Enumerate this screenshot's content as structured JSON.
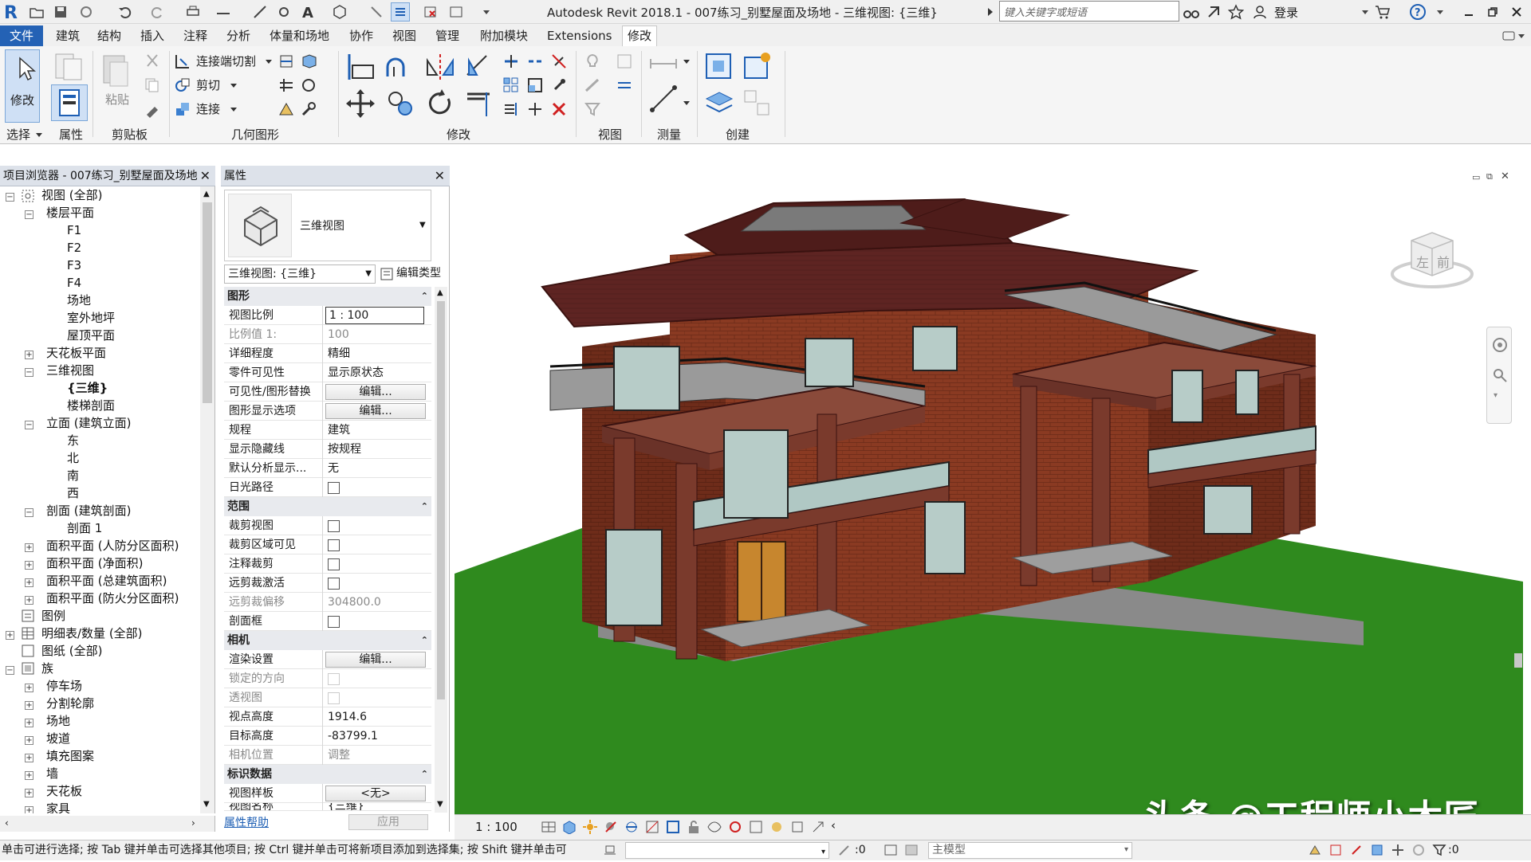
{
  "app": {
    "title": "Autodesk Revit 2018.1 -    007练习_别墅屋面及场地 - 三维视图: {三维}",
    "search_placeholder": "键入关键字或短语",
    "login_label": "登录"
  },
  "ribbon_tabs": [
    {
      "label": "文件"
    },
    {
      "label": "建筑"
    },
    {
      "label": "结构"
    },
    {
      "label": "插入"
    },
    {
      "label": "注释"
    },
    {
      "label": "分析"
    },
    {
      "label": "体量和场地"
    },
    {
      "label": "协作"
    },
    {
      "label": "视图"
    },
    {
      "label": "管理"
    },
    {
      "label": "附加模块"
    },
    {
      "label": "Extensions"
    },
    {
      "label": "修改"
    }
  ],
  "ribbon": {
    "modify_label": "修改",
    "paste_label": "粘贴",
    "cope_label": "连接端切割",
    "cut_label": "剪切",
    "join_label": "连接",
    "panels": {
      "select": "选择",
      "properties": "属性",
      "clipboard": "剪贴板",
      "geometry": "几何图形",
      "modify": "修改",
      "view": "视图",
      "measure": "测量",
      "create": "创建"
    }
  },
  "browser": {
    "title": "项目浏览器 - 007练习_别墅屋面及场地",
    "items": [
      {
        "label": "视图 (全部)"
      },
      {
        "label": "楼层平面"
      },
      {
        "label": "F1"
      },
      {
        "label": "F2"
      },
      {
        "label": "F3"
      },
      {
        "label": "F4"
      },
      {
        "label": "场地"
      },
      {
        "label": "室外地坪"
      },
      {
        "label": "屋顶平面"
      },
      {
        "label": "天花板平面"
      },
      {
        "label": "三维视图"
      },
      {
        "label": "{三维}"
      },
      {
        "label": "楼梯剖面"
      },
      {
        "label": "立面 (建筑立面)"
      },
      {
        "label": "东"
      },
      {
        "label": "北"
      },
      {
        "label": "南"
      },
      {
        "label": "西"
      },
      {
        "label": "剖面 (建筑剖面)"
      },
      {
        "label": "剖面 1"
      },
      {
        "label": "面积平面 (人防分区面积)"
      },
      {
        "label": "面积平面 (净面积)"
      },
      {
        "label": "面积平面 (总建筑面积)"
      },
      {
        "label": "面积平面 (防火分区面积)"
      },
      {
        "label": "图例"
      },
      {
        "label": "明细表/数量 (全部)"
      },
      {
        "label": "图纸 (全部)"
      },
      {
        "label": "族"
      },
      {
        "label": "停车场"
      },
      {
        "label": "分割轮廓"
      },
      {
        "label": "场地"
      },
      {
        "label": "坡道"
      },
      {
        "label": "填充图案"
      },
      {
        "label": "墙"
      },
      {
        "label": "天花板"
      },
      {
        "label": "家具"
      }
    ]
  },
  "properties": {
    "title": "属性",
    "type_name": "三维视图",
    "view_selector": "三维视图: {三维}",
    "edit_type": "编辑类型",
    "groups": {
      "graphics": "图形",
      "extents": "范围",
      "camera": "相机",
      "identity": "标识数据"
    },
    "rows": {
      "view_scale": {
        "name": "视图比例",
        "value": "1 : 100"
      },
      "scale_value": {
        "name": "比例值 1:",
        "value": "100"
      },
      "detail_level": {
        "name": "详细程度",
        "value": "精细"
      },
      "parts_visibility": {
        "name": "零件可见性",
        "value": "显示原状态"
      },
      "vg_overrides": {
        "name": "可见性/图形替换",
        "value": "编辑..."
      },
      "graphic_display": {
        "name": "图形显示选项",
        "value": "编辑..."
      },
      "discipline": {
        "name": "规程",
        "value": "建筑"
      },
      "hidden_lines": {
        "name": "显示隐藏线",
        "value": "按规程"
      },
      "analysis_display": {
        "name": "默认分析显示...",
        "value": "无"
      },
      "sun_path": {
        "name": "日光路径"
      },
      "crop_view": {
        "name": "裁剪视图"
      },
      "crop_visible": {
        "name": "裁剪区域可见"
      },
      "annotation_crop": {
        "name": "注释裁剪"
      },
      "far_clip_active": {
        "name": "远剪裁激活"
      },
      "far_clip_offset": {
        "name": "远剪裁偏移",
        "value": "304800.0"
      },
      "section_box": {
        "name": "剖面框"
      },
      "render_settings": {
        "name": "渲染设置",
        "value": "编辑..."
      },
      "locked_orientation": {
        "name": "锁定的方向"
      },
      "perspective": {
        "name": "透视图"
      },
      "eye_elevation": {
        "name": "视点高度",
        "value": "1914.6"
      },
      "target_elevation": {
        "name": "目标高度",
        "value": "-83799.1"
      },
      "camera_position": {
        "name": "相机位置",
        "value": "调整"
      },
      "view_template": {
        "name": "视图样板",
        "value": "<无>"
      },
      "view_name": {
        "name": "视图名称",
        "value": "{三维}"
      }
    },
    "help_link": "属性帮助",
    "apply_button": "应用"
  },
  "viewcube": {
    "left_label": "左",
    "front_label": "前"
  },
  "view_control": {
    "scale": "1 : 100"
  },
  "status": {
    "message": "单击可进行选择; 按 Tab 键并单击可选择其他项目; 按 Ctrl 键并单击可将新项目添加到选择集; 按 Shift 键并单击可",
    "sel_count": ":0",
    "model_name": "主模型",
    "filter_count": ":0"
  },
  "watermark": "头条 @工程师小木匠",
  "colors": {
    "file_tab": "#2462b5",
    "grass": "#2f8a1e",
    "brick": "#8a3a22",
    "roof": "#5e2422"
  }
}
